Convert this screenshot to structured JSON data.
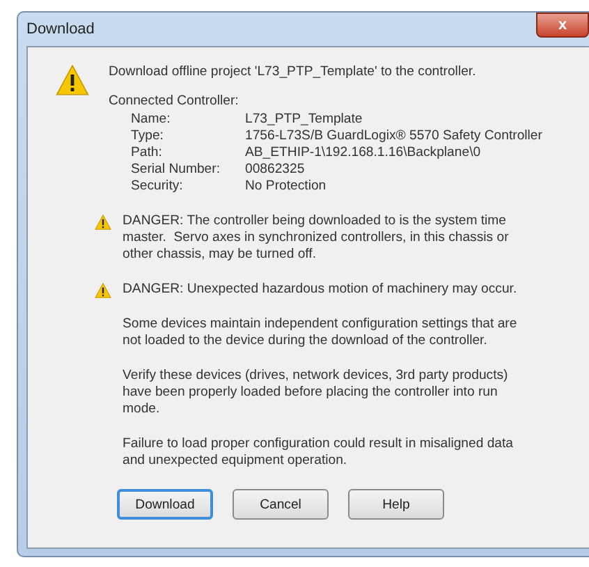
{
  "window": {
    "title": "Download",
    "close": "x"
  },
  "message": "Download offline project 'L73_PTP_Template' to the controller.",
  "connected_controller": {
    "label": "Connected Controller:",
    "fields": [
      {
        "label": "Name:",
        "value": "L73_PTP_Template"
      },
      {
        "label": "Type:",
        "value": "1756-L73S/B GuardLogix® 5570 Safety Controller"
      },
      {
        "label": "Path:",
        "value": "AB_ETHIP-1\\192.168.1.16\\Backplane\\0"
      },
      {
        "label": "Serial Number:",
        "value": "00862325"
      },
      {
        "label": "Security:",
        "value": "No Protection"
      }
    ]
  },
  "warnings": [
    "DANGER: The controller being downloaded to is the system time master.  Servo axes in synchronized controllers, in this chassis or other chassis, may be turned off.",
    "DANGER: Unexpected hazardous motion of machinery may occur."
  ],
  "notes": [
    "Some devices maintain independent configuration settings that are not loaded to the device during the download of the controller.",
    "Verify these devices (drives, network devices, 3rd party products) have been properly loaded before placing the controller into run mode.",
    "Failure to load proper configuration could result in misaligned data and unexpected equipment operation."
  ],
  "buttons": [
    {
      "label": "Download",
      "default": true
    },
    {
      "label": "Cancel",
      "default": false
    },
    {
      "label": "Help",
      "default": false
    }
  ]
}
